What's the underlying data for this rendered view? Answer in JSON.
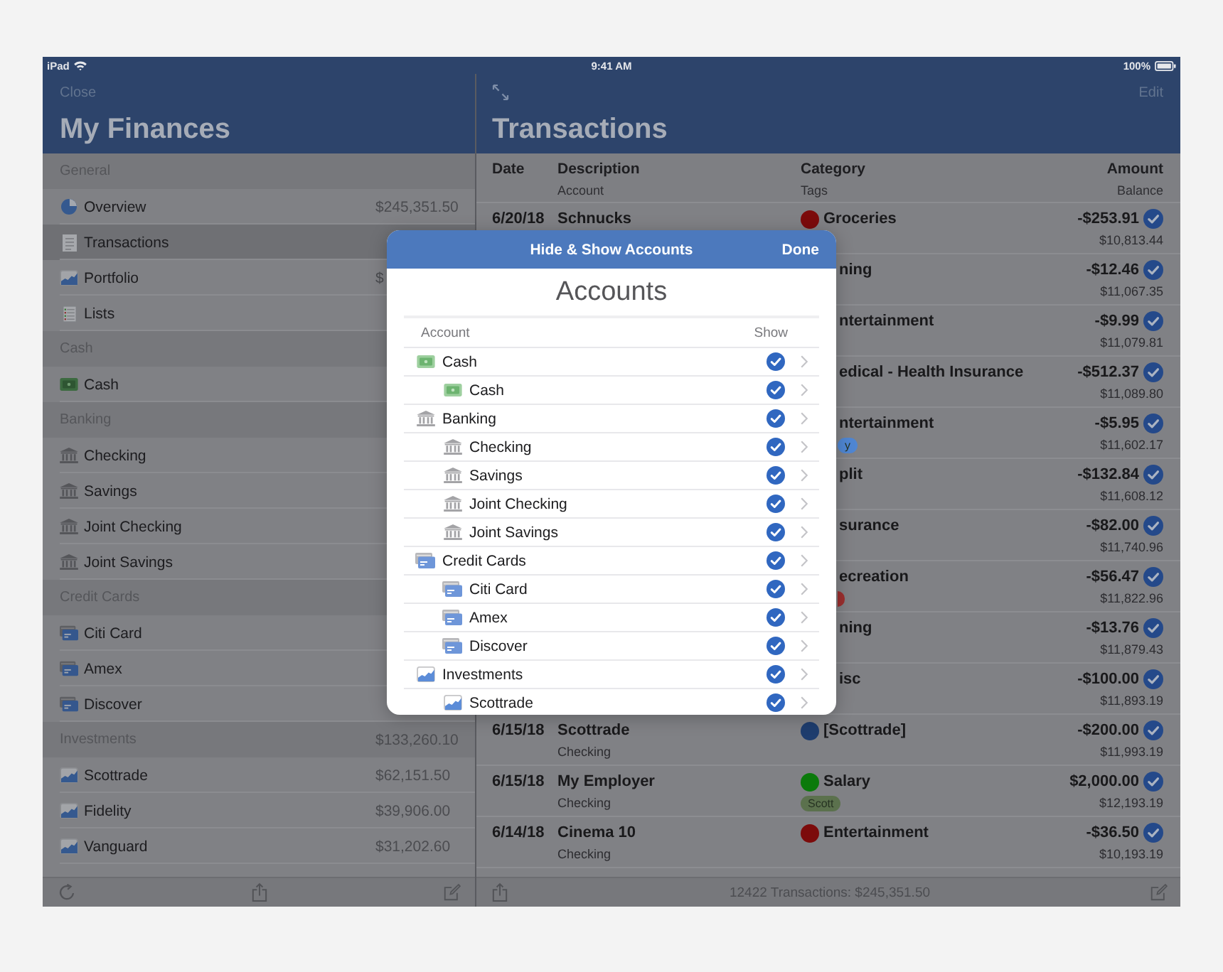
{
  "status_bar": {
    "device": "iPad",
    "time": "9:41 AM",
    "battery": "100%"
  },
  "sidebar": {
    "close": "Close",
    "title": "My Finances",
    "sections": [
      {
        "title": "General",
        "items": [
          {
            "label": "Overview",
            "kind": "overview",
            "amount": "$245,351.50",
            "selected": false
          },
          {
            "label": "Transactions",
            "kind": "transactions",
            "selected": true
          },
          {
            "label": "Portfolio",
            "kind": "portfolio",
            "amount": "$",
            "selected": false
          },
          {
            "label": "Lists",
            "kind": "lists",
            "selected": false
          }
        ]
      },
      {
        "title": "Cash",
        "items": [
          {
            "label": "Cash",
            "kind": "cash",
            "selected": false
          }
        ]
      },
      {
        "title": "Banking",
        "items": [
          {
            "label": "Checking",
            "kind": "bank",
            "selected": false
          },
          {
            "label": "Savings",
            "kind": "bank",
            "selected": false
          },
          {
            "label": "Joint Checking",
            "kind": "bank",
            "selected": false
          },
          {
            "label": "Joint Savings",
            "kind": "bank",
            "selected": false
          }
        ]
      },
      {
        "title": "Credit Cards",
        "items": [
          {
            "label": "Citi Card",
            "kind": "card",
            "selected": false
          },
          {
            "label": "Amex",
            "kind": "card",
            "selected": false
          },
          {
            "label": "Discover",
            "kind": "card",
            "selected": false
          }
        ]
      },
      {
        "title": "Investments",
        "total": "$133,260.10",
        "items": [
          {
            "label": "Scottrade",
            "kind": "investment",
            "amount": "$62,151.50",
            "selected": false
          },
          {
            "label": "Fidelity",
            "kind": "investment",
            "amount": "$39,906.00",
            "selected": false
          },
          {
            "label": "Vanguard",
            "kind": "investment",
            "amount": "$31,202.60",
            "selected": false
          }
        ]
      }
    ]
  },
  "transactions": {
    "title": "Transactions",
    "edit": "Edit",
    "columns": [
      {
        "title": "Date"
      },
      {
        "title": "Description",
        "subtitle": "Account"
      },
      {
        "title": "Category",
        "subtitle": "Tags"
      },
      {
        "title": "Amount",
        "subtitle": "Balance"
      }
    ],
    "rows": [
      {
        "kind": "full",
        "date": "6/20/18",
        "description": "Schnucks",
        "category": "Groceries",
        "color": "#7c0b0b",
        "amount": "-$253.91",
        "balance": "$10,813.44",
        "cleared": true
      },
      {
        "kind": "partial",
        "category": "ning",
        "amount": "-$12.46",
        "balance": "$11,067.35",
        "cleared": true
      },
      {
        "kind": "partial",
        "category": "ntertainment",
        "amount": "-$9.99",
        "balance": "$11,079.81",
        "cleared": true
      },
      {
        "kind": "partial",
        "category": "edical - Health Insurance",
        "amount": "-$512.37",
        "balance": "$11,089.80",
        "cleared": true
      },
      {
        "kind": "partial",
        "category": "ntertainment",
        "tags": [
          {
            "label": "y",
            "color": "#4f86d2"
          }
        ],
        "amount": "-$5.95",
        "balance": "$11,602.17",
        "cleared": true
      },
      {
        "kind": "partial",
        "category": "plit",
        "amount": "-$132.84",
        "balance": "$11,608.12",
        "cleared": true
      },
      {
        "kind": "partial",
        "category": "surance",
        "amount": "-$82.00",
        "balance": "$11,740.96",
        "cleared": true
      },
      {
        "kind": "partial",
        "category": "ecreation",
        "tags": [
          {
            "color": "#9b2f2f"
          }
        ],
        "amount": "-$56.47",
        "balance": "$11,822.96",
        "cleared": true
      },
      {
        "kind": "partial",
        "category": "ning",
        "amount": "-$13.76",
        "balance": "$11,879.43",
        "cleared": true
      },
      {
        "kind": "partial",
        "category": "isc",
        "amount": "-$100.00",
        "balance": "$11,893.19",
        "cleared": true
      },
      {
        "kind": "full",
        "date": "6/15/18",
        "description": "Scottrade",
        "account": "Checking",
        "category": "[Scottrade]",
        "color": "#1e3d6e",
        "amount": "-$200.00",
        "balance": "$11,993.19",
        "cleared": true
      },
      {
        "kind": "full",
        "date": "6/15/18",
        "description": "My Employer",
        "account": "Checking",
        "category": "Salary",
        "color": "#0b7a0b",
        "tags": [
          {
            "label": "Scott",
            "color": "#5b714d"
          }
        ],
        "amount": "$2,000.00",
        "balance": "$12,193.19",
        "cleared": true
      },
      {
        "kind": "full",
        "date": "6/14/18",
        "description": "Cinema 10",
        "account": "Checking",
        "category": "Entertainment",
        "color": "#7c0b0b",
        "amount": "-$36.50",
        "balance": "$10,193.19",
        "cleared": true
      }
    ],
    "footer": "12422 Transactions: $245,351.50"
  },
  "sheet": {
    "title": "Hide & Show Accounts",
    "done": "Done",
    "heading": "Accounts",
    "columns": [
      {
        "title": "Account"
      },
      {
        "title": "Show"
      }
    ],
    "accounts": [
      {
        "name": "Cash",
        "kind": "cash",
        "show": true,
        "children": [
          {
            "name": "Cash",
            "kind": "cash",
            "show": true
          }
        ]
      },
      {
        "name": "Banking",
        "kind": "bank",
        "show": true,
        "children": [
          {
            "name": "Checking",
            "kind": "bank",
            "show": true
          },
          {
            "name": "Savings",
            "kind": "bank",
            "show": true
          },
          {
            "name": "Joint Checking",
            "kind": "bank",
            "show": true
          },
          {
            "name": "Joint Savings",
            "kind": "bank",
            "show": true
          }
        ]
      },
      {
        "name": "Credit Cards",
        "kind": "card",
        "show": true,
        "children": [
          {
            "name": "Citi Card",
            "kind": "card",
            "show": true
          },
          {
            "name": "Amex",
            "kind": "card",
            "show": true
          },
          {
            "name": "Discover",
            "kind": "card",
            "show": true
          }
        ]
      },
      {
        "name": "Investments",
        "kind": "investment",
        "show": true,
        "children": [
          {
            "name": "Scottrade",
            "kind": "investment",
            "show": true
          }
        ]
      }
    ]
  }
}
